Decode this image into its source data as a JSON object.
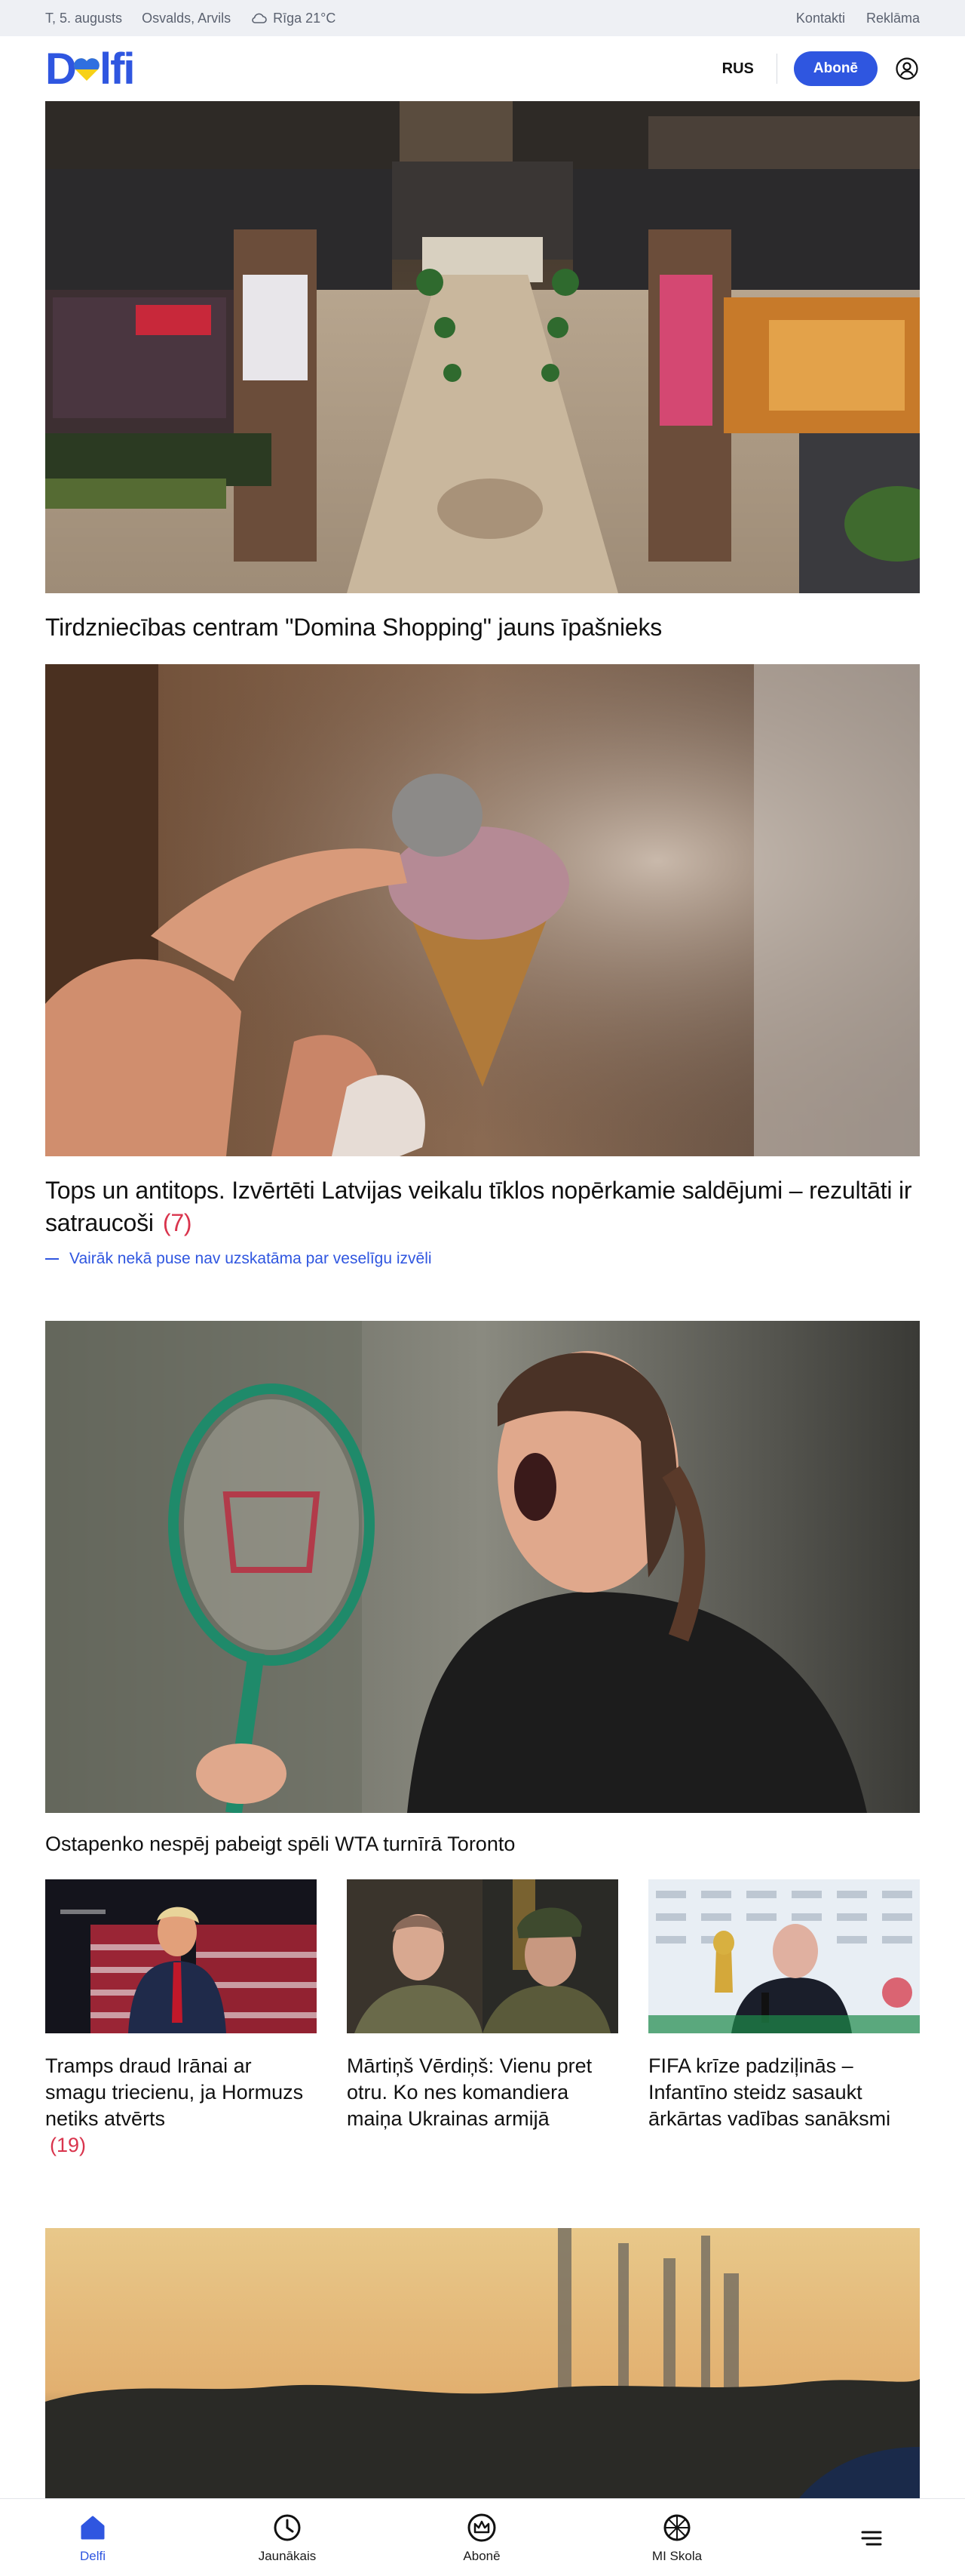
{
  "topbar": {
    "date": "T, 5. augusts",
    "namedays": "Osvalds, Arvils",
    "weather": "Rīga 21°C",
    "links": [
      "Kontakti",
      "Reklāma"
    ]
  },
  "header": {
    "logo": "Delfi",
    "lang": "RUS",
    "subscribe": "Abonē"
  },
  "articles": [
    {
      "title": "Tirdzniecības centram \"Domina Shopping\" jauns īpašnieks"
    },
    {
      "title": "Tops un antitops. Izvērtēti Latvijas veikalu tīklos nopērkamie saldējumi – rezultāti ir satraucoši",
      "comments": "(7)",
      "sublink": "Vairāk nekā puse nav uzskatāma par veselīgu izvēli"
    },
    {
      "title": "Ostapenko nespēj pabeigt spēli WTA turnīrā Toronto"
    }
  ],
  "cards": [
    {
      "title": "Tramps draud Irānai ar smagu triecienu, ja Hormuzs netiks atvērts",
      "comments": "(19)"
    },
    {
      "title": "Mārtiņš Vērdiņš: Vienu pret otru. Ko nes komandiera maiņa Ukrainas armijā"
    },
    {
      "title": "FIFA krīze padziļinās – Infantīno steidz sasaukt ārkārtas vadības sanāksmi"
    }
  ],
  "bottomnav": [
    {
      "label": "Delfi",
      "icon": "home-icon"
    },
    {
      "label": "Jaunākais",
      "icon": "clock-icon"
    },
    {
      "label": "Abonē",
      "icon": "crown-icon"
    },
    {
      "label": "MI Skola",
      "icon": "network-icon"
    },
    {
      "label": "",
      "icon": "menu-icon"
    }
  ],
  "colors": {
    "accent": "#2f56e0",
    "comments": "#d9344d",
    "topbar_bg": "#eef0f4"
  }
}
